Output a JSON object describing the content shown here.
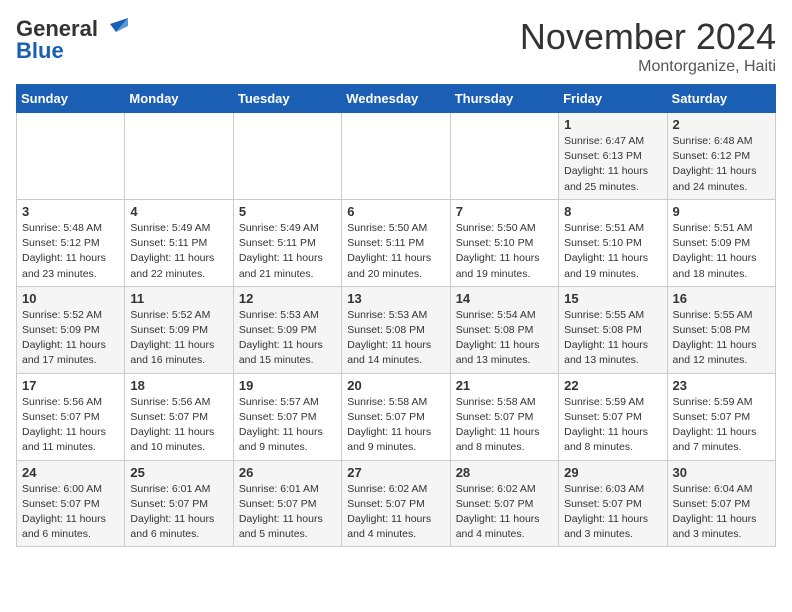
{
  "header": {
    "logo_line1": "General",
    "logo_line2": "Blue",
    "month_title": "November 2024",
    "subtitle": "Montorganize, Haiti"
  },
  "days_of_week": [
    "Sunday",
    "Monday",
    "Tuesday",
    "Wednesday",
    "Thursday",
    "Friday",
    "Saturday"
  ],
  "weeks": [
    [
      {
        "day": "",
        "info": ""
      },
      {
        "day": "",
        "info": ""
      },
      {
        "day": "",
        "info": ""
      },
      {
        "day": "",
        "info": ""
      },
      {
        "day": "",
        "info": ""
      },
      {
        "day": "1",
        "info": "Sunrise: 6:47 AM\nSunset: 6:13 PM\nDaylight: 11 hours\nand 25 minutes."
      },
      {
        "day": "2",
        "info": "Sunrise: 6:48 AM\nSunset: 6:12 PM\nDaylight: 11 hours\nand 24 minutes."
      }
    ],
    [
      {
        "day": "3",
        "info": "Sunrise: 5:48 AM\nSunset: 5:12 PM\nDaylight: 11 hours\nand 23 minutes."
      },
      {
        "day": "4",
        "info": "Sunrise: 5:49 AM\nSunset: 5:11 PM\nDaylight: 11 hours\nand 22 minutes."
      },
      {
        "day": "5",
        "info": "Sunrise: 5:49 AM\nSunset: 5:11 PM\nDaylight: 11 hours\nand 21 minutes."
      },
      {
        "day": "6",
        "info": "Sunrise: 5:50 AM\nSunset: 5:11 PM\nDaylight: 11 hours\nand 20 minutes."
      },
      {
        "day": "7",
        "info": "Sunrise: 5:50 AM\nSunset: 5:10 PM\nDaylight: 11 hours\nand 19 minutes."
      },
      {
        "day": "8",
        "info": "Sunrise: 5:51 AM\nSunset: 5:10 PM\nDaylight: 11 hours\nand 19 minutes."
      },
      {
        "day": "9",
        "info": "Sunrise: 5:51 AM\nSunset: 5:09 PM\nDaylight: 11 hours\nand 18 minutes."
      }
    ],
    [
      {
        "day": "10",
        "info": "Sunrise: 5:52 AM\nSunset: 5:09 PM\nDaylight: 11 hours\nand 17 minutes."
      },
      {
        "day": "11",
        "info": "Sunrise: 5:52 AM\nSunset: 5:09 PM\nDaylight: 11 hours\nand 16 minutes."
      },
      {
        "day": "12",
        "info": "Sunrise: 5:53 AM\nSunset: 5:09 PM\nDaylight: 11 hours\nand 15 minutes."
      },
      {
        "day": "13",
        "info": "Sunrise: 5:53 AM\nSunset: 5:08 PM\nDaylight: 11 hours\nand 14 minutes."
      },
      {
        "day": "14",
        "info": "Sunrise: 5:54 AM\nSunset: 5:08 PM\nDaylight: 11 hours\nand 13 minutes."
      },
      {
        "day": "15",
        "info": "Sunrise: 5:55 AM\nSunset: 5:08 PM\nDaylight: 11 hours\nand 13 minutes."
      },
      {
        "day": "16",
        "info": "Sunrise: 5:55 AM\nSunset: 5:08 PM\nDaylight: 11 hours\nand 12 minutes."
      }
    ],
    [
      {
        "day": "17",
        "info": "Sunrise: 5:56 AM\nSunset: 5:07 PM\nDaylight: 11 hours\nand 11 minutes."
      },
      {
        "day": "18",
        "info": "Sunrise: 5:56 AM\nSunset: 5:07 PM\nDaylight: 11 hours\nand 10 minutes."
      },
      {
        "day": "19",
        "info": "Sunrise: 5:57 AM\nSunset: 5:07 PM\nDaylight: 11 hours\nand 9 minutes."
      },
      {
        "day": "20",
        "info": "Sunrise: 5:58 AM\nSunset: 5:07 PM\nDaylight: 11 hours\nand 9 minutes."
      },
      {
        "day": "21",
        "info": "Sunrise: 5:58 AM\nSunset: 5:07 PM\nDaylight: 11 hours\nand 8 minutes."
      },
      {
        "day": "22",
        "info": "Sunrise: 5:59 AM\nSunset: 5:07 PM\nDaylight: 11 hours\nand 8 minutes."
      },
      {
        "day": "23",
        "info": "Sunrise: 5:59 AM\nSunset: 5:07 PM\nDaylight: 11 hours\nand 7 minutes."
      }
    ],
    [
      {
        "day": "24",
        "info": "Sunrise: 6:00 AM\nSunset: 5:07 PM\nDaylight: 11 hours\nand 6 minutes."
      },
      {
        "day": "25",
        "info": "Sunrise: 6:01 AM\nSunset: 5:07 PM\nDaylight: 11 hours\nand 6 minutes."
      },
      {
        "day": "26",
        "info": "Sunrise: 6:01 AM\nSunset: 5:07 PM\nDaylight: 11 hours\nand 5 minutes."
      },
      {
        "day": "27",
        "info": "Sunrise: 6:02 AM\nSunset: 5:07 PM\nDaylight: 11 hours\nand 4 minutes."
      },
      {
        "day": "28",
        "info": "Sunrise: 6:02 AM\nSunset: 5:07 PM\nDaylight: 11 hours\nand 4 minutes."
      },
      {
        "day": "29",
        "info": "Sunrise: 6:03 AM\nSunset: 5:07 PM\nDaylight: 11 hours\nand 3 minutes."
      },
      {
        "day": "30",
        "info": "Sunrise: 6:04 AM\nSunset: 5:07 PM\nDaylight: 11 hours\nand 3 minutes."
      }
    ]
  ]
}
